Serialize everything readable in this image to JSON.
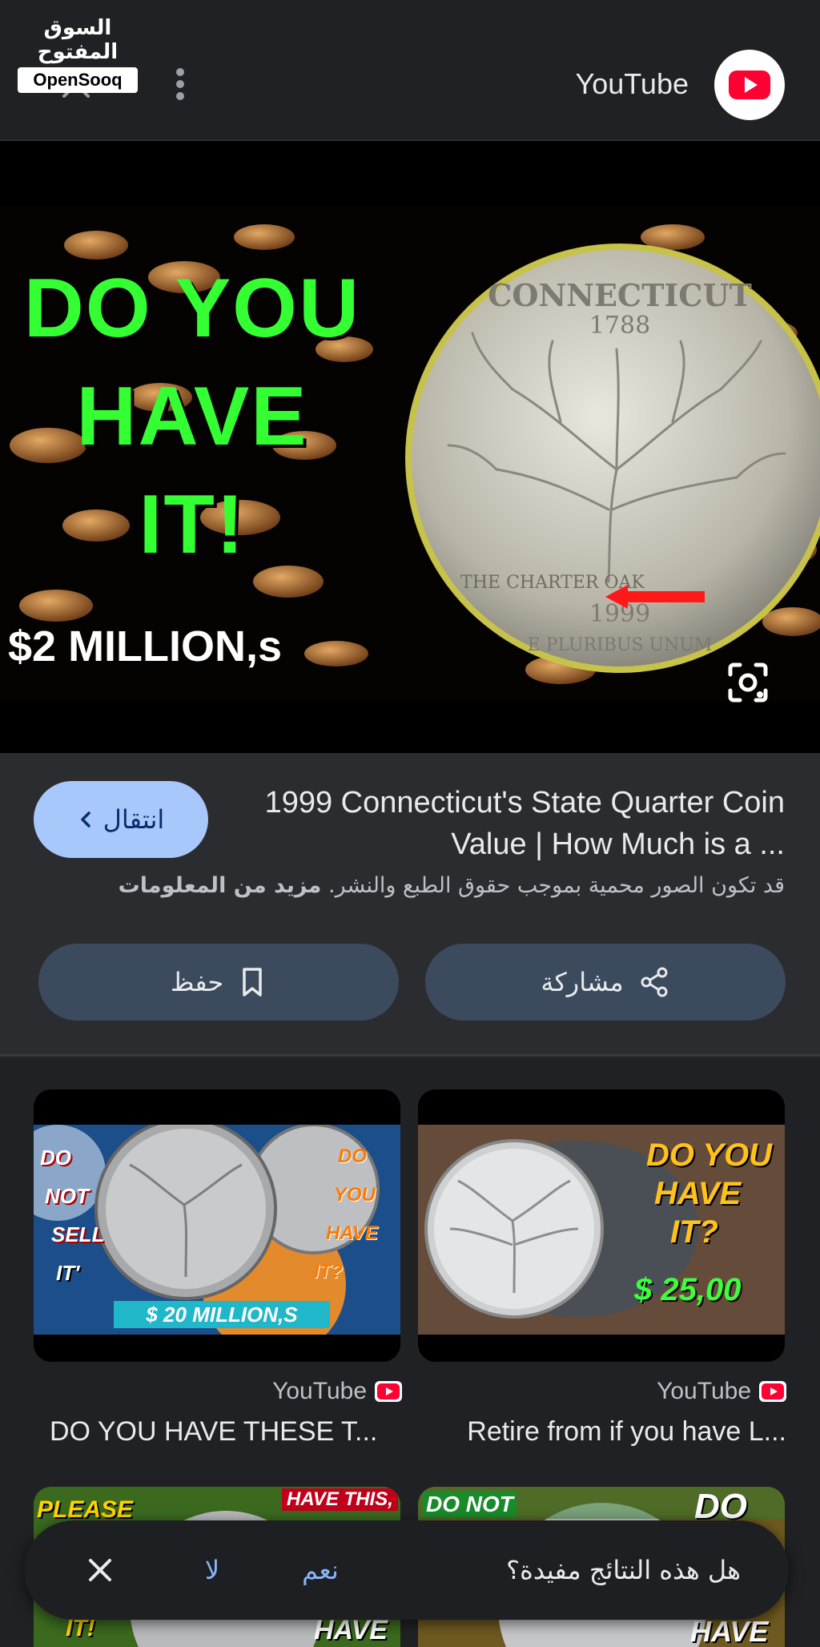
{
  "watermark": {
    "arabic": "السوق المفتوح",
    "english": "OpenSooq"
  },
  "header": {
    "title": "YouTube"
  },
  "hero": {
    "line1": "DO YOU",
    "line2": "HAVE",
    "line3": "IT!",
    "price_text": "$2 MILLION,s",
    "coin": {
      "state": "CONNECTICUT",
      "year_top": "1788",
      "tree_label": "THE CHARTER OAK",
      "year_bottom": "1999",
      "motto": "E PLURIBUS UNUM"
    }
  },
  "result": {
    "visit_label": "انتقال",
    "title": "1999 Connecticut's State Quarter Coin Value | How Much is a ...",
    "copyright_notice": "قد تكون الصور محمية بموجب حقوق الطبع والنشر.",
    "learn_more": "مزيد من المعلومات",
    "share_label": "مشاركة",
    "save_label": "حفظ"
  },
  "related": [
    {
      "source": "YouTube",
      "caption": "Retire from if you have L...",
      "thumb_texts": [
        "DO YOU",
        "HAVE",
        "IT?",
        "$ 25,00"
      ]
    },
    {
      "source": "YouTube",
      "caption": "DO YOU HAVE THESE T...",
      "thumb_texts": [
        "DO",
        "NOT",
        "SELL",
        "IT'",
        "$ 20 MILLION,S",
        "DO",
        "YOU",
        "HAVE",
        "IT?"
      ]
    },
    {
      "source": "",
      "caption": "",
      "thumb_texts": [
        "DO NOT",
        "DO",
        "HAVE"
      ]
    },
    {
      "source": "",
      "caption": "",
      "thumb_texts": [
        "PLEASE",
        "HAVE THIS,",
        "IT!",
        "HAVE"
      ]
    }
  ],
  "feedback": {
    "question": "هل هذه النتائج مفيدة؟",
    "yes": "نعم",
    "no": "لا"
  },
  "colors": {
    "background": "#202124",
    "panel": "#2b2c30",
    "accent_button": "#a8c7fa",
    "pill_button": "#3c4a5d",
    "link": "#8ab4f8",
    "hero_green": "#33ff33",
    "youtube_red": "#ff0033"
  }
}
